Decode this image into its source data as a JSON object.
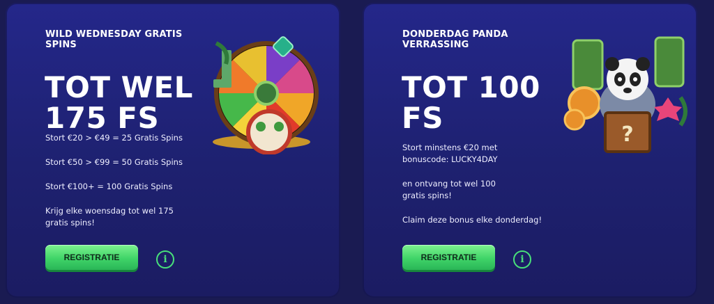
{
  "cards": [
    {
      "title": "WILD WEDNESDAY GRATIS SPINS",
      "amount_line1": "TOT WEL",
      "amount_line2": "175 FS",
      "lines": [
        "Stort €20 > €49 = 25 Gratis Spins",
        "Stort €50 > €99 = 50 Gratis Spins",
        "Stort €100+ = 100 Gratis Spins",
        "Krijg elke woensdag tot wel 175 gratis spins!"
      ],
      "button_label": "REGISTRATIE",
      "info_icon": "i"
    },
    {
      "title": "DONDERDAG PANDA VERRASSING",
      "amount_line1": "TOT 100",
      "amount_line2": "FS",
      "lines": [
        "Stort minstens €20 met bonuscode: LUCKY4DAY",
        "en ontvang tot wel 100 gratis spins!",
        "Claim deze bonus elke donderdag!"
      ],
      "button_label": "REGISTRATIE",
      "info_icon": "i"
    }
  ],
  "colors": {
    "background": "#1a1b52",
    "card": "#24278a",
    "button": "#3fd468",
    "info": "#48e07a"
  },
  "icons": [
    "wheel-illustration-icon",
    "panda-illustration-icon",
    "info-icon"
  ]
}
